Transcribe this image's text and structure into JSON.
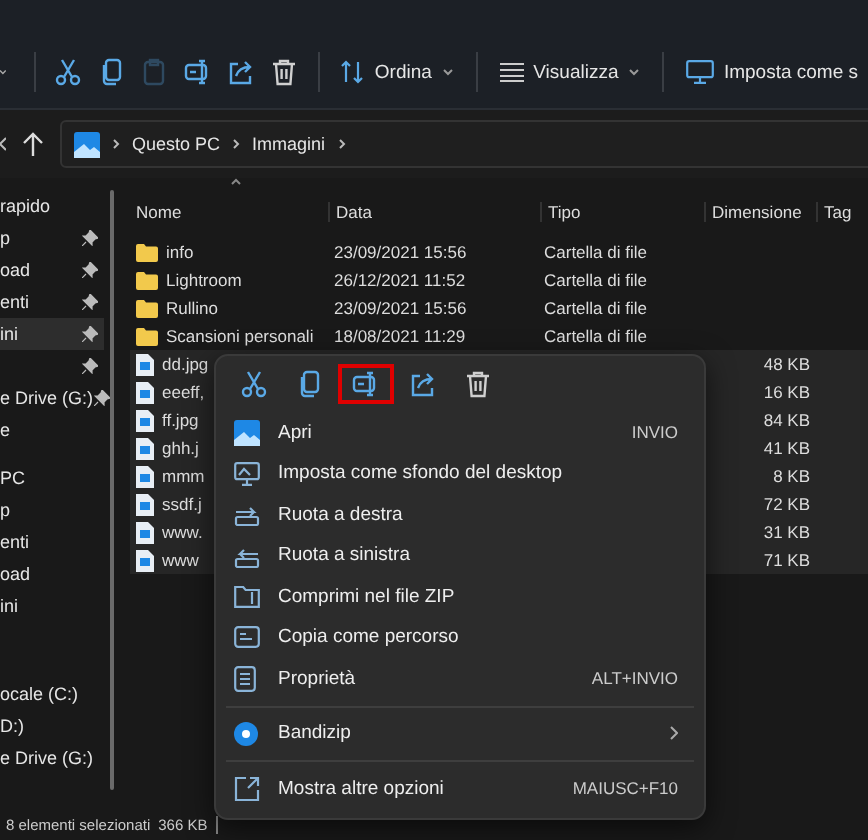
{
  "toolbar": {
    "actions": [
      {
        "kind": "cut",
        "disabled": false
      },
      {
        "kind": "copy",
        "disabled": false
      },
      {
        "kind": "paste",
        "disabled": true
      },
      {
        "kind": "rename",
        "disabled": false
      },
      {
        "kind": "share",
        "disabled": false
      },
      {
        "kind": "delete",
        "disabled": false
      }
    ],
    "menus": [
      {
        "kind": "sort",
        "label": "Ordina"
      },
      {
        "kind": "view",
        "label": "Visualizza"
      },
      {
        "kind": "wallpaper",
        "label": "Imposta come s"
      }
    ]
  },
  "address": {
    "path": [
      "Questo PC",
      "Immagini"
    ]
  },
  "sidebar": {
    "items": [
      {
        "label": "rapido",
        "pinned": false,
        "selected": false
      },
      {
        "label": "p",
        "pinned": true,
        "selected": false
      },
      {
        "label": "oad",
        "pinned": true,
        "selected": false
      },
      {
        "label": "enti",
        "pinned": true,
        "selected": false
      },
      {
        "label": "ini",
        "pinned": true,
        "selected": true
      },
      {
        "pinned": true,
        "selected": false
      },
      {
        "label": "e Drive (G:)",
        "pinned": true,
        "selected": false
      },
      {
        "label": "e",
        "pinned": false,
        "selected": false
      },
      {
        "label": "PC",
        "pinned": false,
        "selected": false
      },
      {
        "label": "p",
        "pinned": false,
        "selected": false
      },
      {
        "label": "enti",
        "pinned": false,
        "selected": false
      },
      {
        "label": "oad",
        "pinned": false,
        "selected": false
      },
      {
        "label": "ini",
        "pinned": false,
        "selected": false
      },
      {
        "label": "ocale (C:)",
        "pinned": false,
        "selected": false
      },
      {
        "label": "D:)",
        "pinned": false,
        "selected": false
      },
      {
        "label": "e Drive (G:)",
        "pinned": false,
        "selected": false
      }
    ]
  },
  "table": {
    "columns": [
      "Nome",
      "Data",
      "Tipo",
      "Dimensione",
      "Tag"
    ],
    "rows": [
      {
        "kind": "folder",
        "name": "info",
        "date": "23/09/2021 15:56",
        "type": "Cartella di file",
        "selected": false
      },
      {
        "kind": "folder",
        "name": "Lightroom",
        "date": "26/12/2021 11:52",
        "type": "Cartella di file",
        "selected": false
      },
      {
        "kind": "folder",
        "name": "Rullino",
        "date": "23/09/2021 15:56",
        "type": "Cartella di file",
        "selected": false
      },
      {
        "kind": "folder",
        "name": "Scansioni personali",
        "date": "18/08/2021 11:29",
        "type": "Cartella di file",
        "selected": false
      },
      {
        "kind": "image",
        "name": "dd.jpg",
        "size": "48 KB",
        "selected": true
      },
      {
        "kind": "image",
        "name": "eeeff,",
        "size": "16 KB",
        "selected": true
      },
      {
        "kind": "image",
        "name": "ff.jpg",
        "size": "84 KB",
        "selected": true
      },
      {
        "kind": "image",
        "name": "ghh.j",
        "size": "41 KB",
        "selected": true
      },
      {
        "kind": "image",
        "name": "mmm",
        "size": "8 KB",
        "selected": true
      },
      {
        "kind": "image",
        "name": "ssdf.j",
        "size": "72 KB",
        "selected": true
      },
      {
        "kind": "image",
        "name": "www.",
        "size": "31 KB",
        "selected": true
      },
      {
        "kind": "image",
        "name": "www",
        "size": "71 KB",
        "selected": true
      }
    ]
  },
  "context_menu": {
    "actions": [
      {
        "kind": "cut",
        "highlighted": false
      },
      {
        "kind": "copy",
        "highlighted": false
      },
      {
        "kind": "rename",
        "highlighted": true
      },
      {
        "kind": "share",
        "highlighted": false
      },
      {
        "kind": "delete",
        "highlighted": false
      }
    ],
    "items": [
      {
        "kind": "open",
        "label": "Apri",
        "shortcut": "INVIO",
        "submenu": false,
        "separator_before": false
      },
      {
        "kind": "wallpaper",
        "label": "Imposta come sfondo del desktop",
        "submenu": false,
        "separator_before": false
      },
      {
        "kind": "rotate-right",
        "label": "Ruota a destra",
        "submenu": false,
        "separator_before": false
      },
      {
        "kind": "rotate-left",
        "label": "Ruota a sinistra",
        "submenu": false,
        "separator_before": false
      },
      {
        "kind": "zip",
        "label": "Comprimi nel file ZIP",
        "submenu": false,
        "separator_before": false
      },
      {
        "kind": "path",
        "label": "Copia come percorso",
        "submenu": false,
        "separator_before": false
      },
      {
        "kind": "properties",
        "label": "Proprietà",
        "shortcut": "ALT+INVIO",
        "submenu": false,
        "separator_before": false
      },
      {
        "kind": "bandizip",
        "label": "Bandizip",
        "submenu": true,
        "separator_before": true
      },
      {
        "kind": "more",
        "label": "Mostra altre opzioni",
        "shortcut": "MAIUSC+F10",
        "submenu": false,
        "separator_before": true
      }
    ]
  },
  "status_bar": {
    "selection": "8 elementi selezionati",
    "size": "366 KB"
  }
}
